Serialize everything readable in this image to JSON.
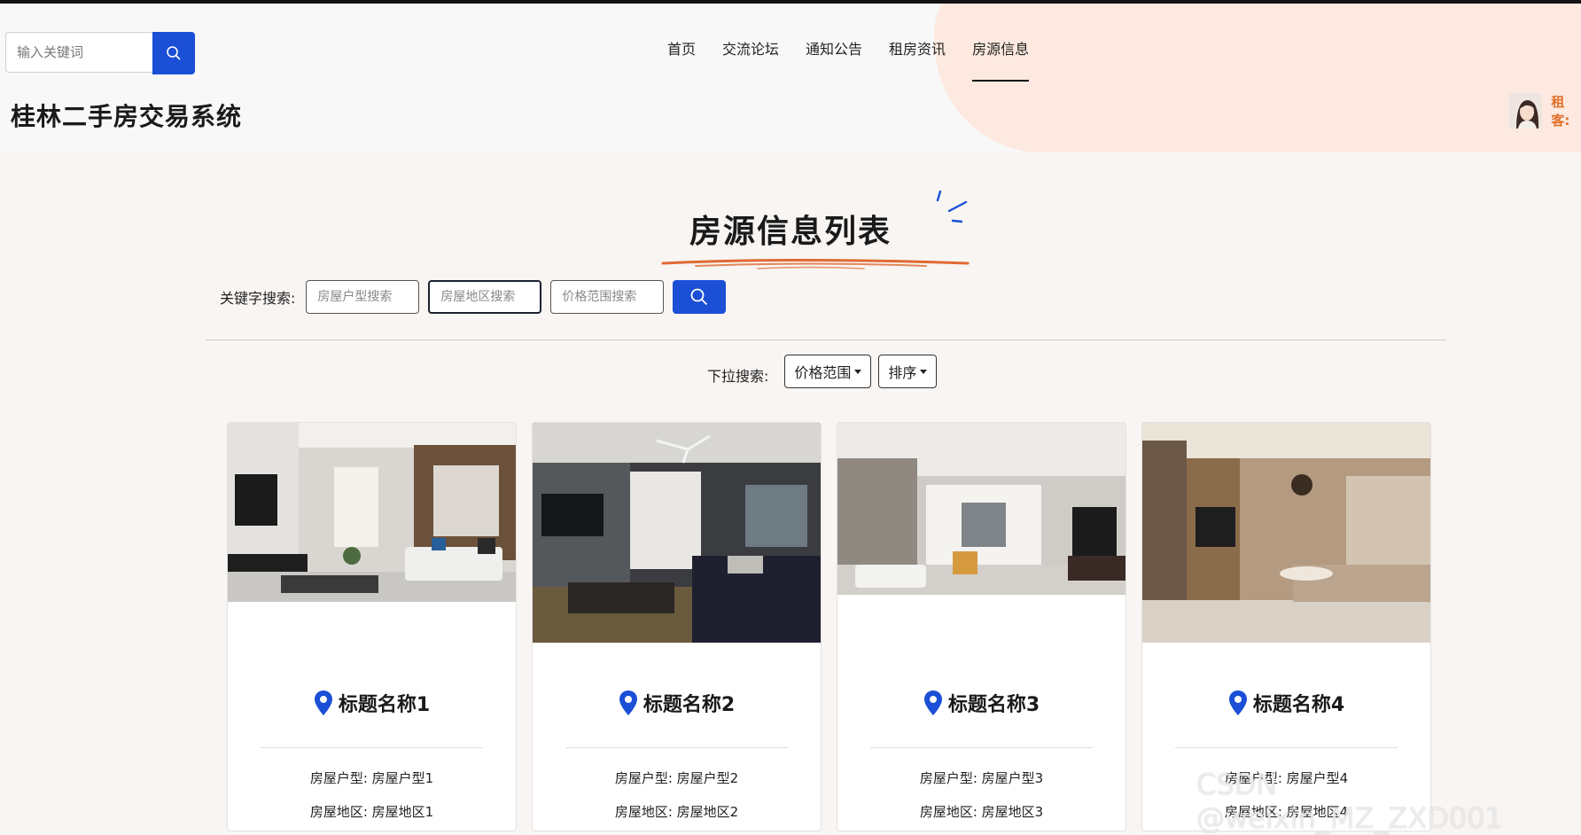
{
  "header": {
    "search_placeholder": "输入关键词",
    "site_title": "桂林二手房交易系统",
    "nav": [
      "首页",
      "交流论坛",
      "通知公告",
      "租房资讯",
      "房源信息"
    ],
    "active_nav": "房源信息",
    "username": "租客:"
  },
  "section": {
    "title": "房源信息列表"
  },
  "filters": {
    "keyword_label": "关键字搜索:",
    "placeholders": [
      "房屋户型搜索",
      "房屋地区搜索",
      "价格范围搜索"
    ],
    "dropdown_label": "下拉搜索:",
    "dropdowns": [
      "价格范围",
      "排序"
    ]
  },
  "cards": [
    {
      "title": "标题名称1",
      "line1": "房屋户型: 房屋户型1",
      "line2": "房屋地区: 房屋地区1"
    },
    {
      "title": "标题名称2",
      "line1": "房屋户型: 房屋户型2",
      "line2": "房屋地区: 房屋地区2"
    },
    {
      "title": "标题名称3",
      "line1": "房屋户型: 房屋户型3",
      "line2": "房屋地区: 房屋地区3"
    },
    {
      "title": "标题名称4",
      "line1": "房屋户型: 房屋户型4",
      "line2": "房屋地区: 房屋地区4"
    }
  ],
  "watermark": "CSDN @weixin_MZ_ZXD001",
  "colors": {
    "accent": "#1a4fd6",
    "user": "#e0702a",
    "pin": "#1a4fd6"
  },
  "icons": [
    "search-icon",
    "location-pin-icon",
    "chevron-down-icon"
  ]
}
